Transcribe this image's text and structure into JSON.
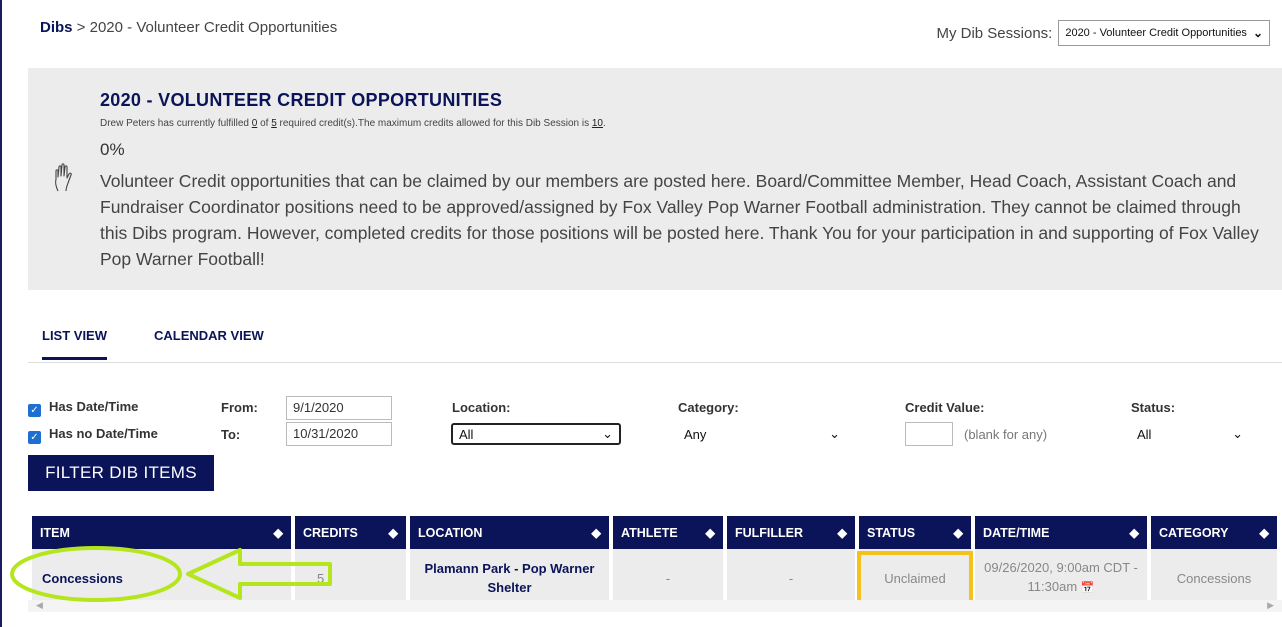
{
  "breadcrumb": {
    "root": "Dibs",
    "separator": " > ",
    "current": "2020 - Volunteer Credit Opportunities"
  },
  "sessions": {
    "label": "My Dib Sessions:",
    "selected": "2020 - Volunteer Credit Opportunities"
  },
  "banner": {
    "title": "2020 - VOLUNTEER CREDIT OPPORTUNITIES",
    "sub_a": "Drew Peters has currently fulfilled ",
    "fulfilled": "0",
    "sub_b": " of ",
    "required": "5",
    "sub_c": " required credit(s).The maximum credits allowed for this Dib Session is ",
    "max": "10",
    "sub_d": ".",
    "progress": "0%",
    "progress_value": 0,
    "description": "Volunteer Credit opportunities that can be claimed by our members are posted here. Board/Committee Member, Head Coach, Assistant Coach and Fundraiser Coordinator positions need to be approved/assigned by Fox Valley Pop Warner Football administration. They cannot be claimed through this Dibs program. However, completed credits for those positions will be posted here. Thank You for your participation in and supporting of Fox Valley Pop Warner Football!",
    "icon": "hand-icon"
  },
  "tabs": [
    {
      "label": "LIST VIEW",
      "active": true
    },
    {
      "label": "CALENDAR VIEW",
      "active": false
    }
  ],
  "filters": {
    "has_datetime": "Has Date/Time",
    "has_no_datetime": "Has no Date/Time",
    "from_label": "From:",
    "from_value": "9/1/2020",
    "to_label": "To:",
    "to_value": "10/31/2020",
    "location_label": "Location:",
    "location_value": "All",
    "category_label": "Category:",
    "category_value": "Any",
    "credit_label": "Credit Value:",
    "credit_hint": "(blank for any)",
    "status_label": "Status:",
    "status_value": "All",
    "button": "FILTER DIB ITEMS"
  },
  "table": {
    "headers": [
      "ITEM",
      "CREDITS",
      "LOCATION",
      "ATHLETE",
      "FULFILLER",
      "STATUS",
      "DATE/TIME",
      "CATEGORY"
    ],
    "rows": [
      {
        "item": "Concessions",
        "credits": "5",
        "location": "Plamann Park - Pop Warner Shelter",
        "athlete": "-",
        "fulfiller": "-",
        "status": "Unclaimed",
        "datetime": "09/26/2020, 9:00am CDT - 11:30am",
        "category": "Concessions"
      }
    ]
  },
  "colors": {
    "navy": "#0b1458",
    "banner_bg": "#ececec",
    "highlight_yellow": "#f5c21b",
    "annotation_green": "#b5e61d"
  }
}
